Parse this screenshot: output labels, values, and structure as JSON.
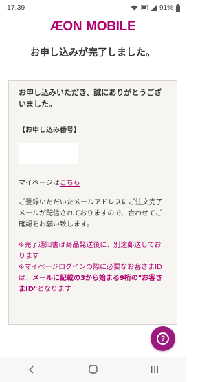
{
  "status_bar": {
    "time": "17:39",
    "battery": "91%",
    "icons": [
      "wifi-icon",
      "data-icon",
      "signal-icon",
      "battery-icon"
    ]
  },
  "brand": {
    "logo_word1": "ÆON",
    "logo_word2": "MOBILE",
    "color": "#b0006f"
  },
  "headline": "お申し込みが完了しました。",
  "card": {
    "thanks": "お申し込みいただき、誠にありがとうございました。",
    "order_heading": "【お申し込み番号】",
    "order_value": "",
    "mypage_prefix": "マイページは",
    "mypage_link": "こちら",
    "mail_note": "ご登録いただいたメールアドレスにご注文完了メールが配信されておりますので、合わせてご確認をお願い致します。",
    "note1": "※完了通知書は商品発送後に、別途郵送しております",
    "note2_prefix": "※マイページログインの際に必要なお客さまIDは、",
    "note2_bold": "メールに記載の3から始まる9桁の\"お客さまID\"",
    "note2_suffix": "となります"
  },
  "help_button": {
    "icon": "question-icon",
    "color": "#9c1a7f"
  },
  "nav_bar": {
    "buttons": [
      "back-icon",
      "home-icon",
      "recents-icon"
    ]
  }
}
